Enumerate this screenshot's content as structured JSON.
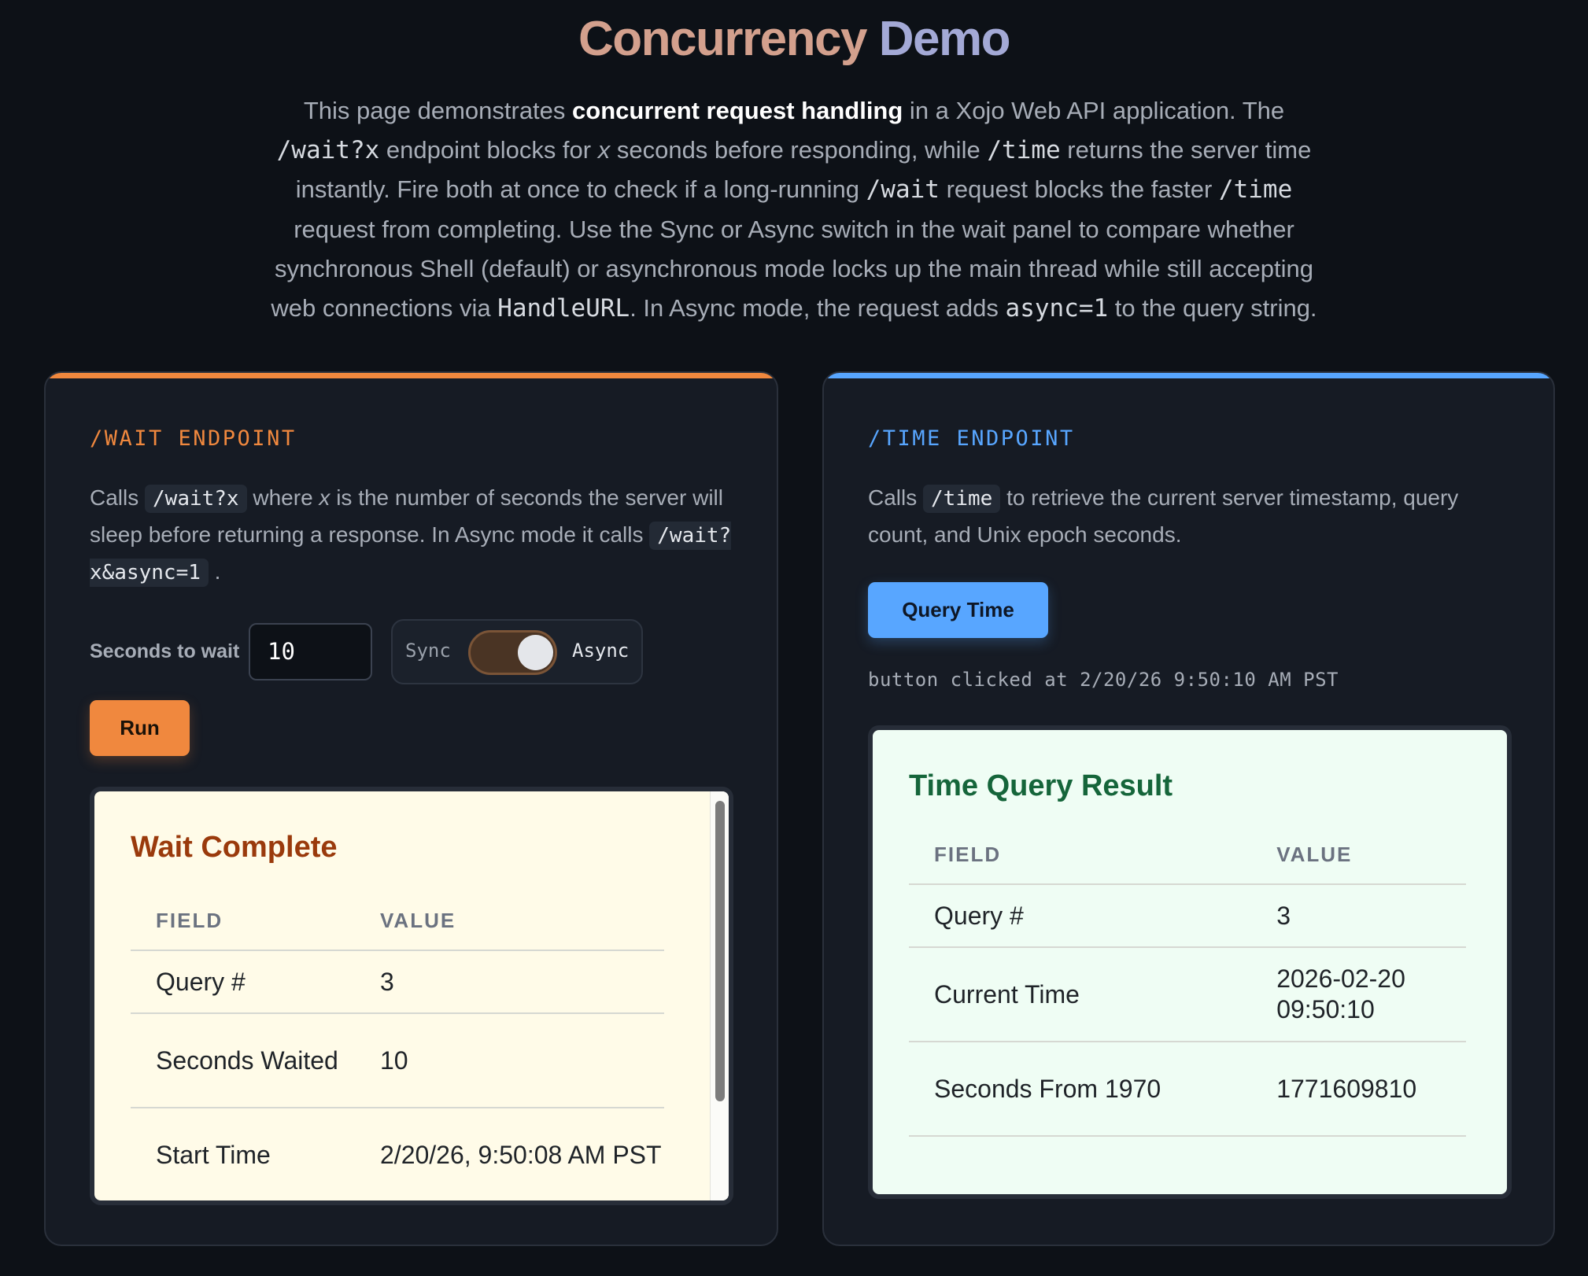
{
  "header": {
    "title_part1": "Concurrency",
    "title_part2": "Demo",
    "intro": {
      "s1": "This page demonstrates ",
      "s1_bold": "concurrent request handling",
      "s2": " in a Xojo Web API application. The ",
      "code_wait_x": "/wait?x",
      "s3": " endpoint blocks for ",
      "x_italic": "x",
      "s4": " seconds before responding, while ",
      "code_time": "/time",
      "s5": " returns the server time instantly. Fire both at once to check if a long-running ",
      "code_wait": "/wait",
      "s6": " request blocks the faster ",
      "code_time2": "/time",
      "s7": " request from completing. Use the Sync or Async switch in the wait panel to compare whether synchronous Shell (default) or asynchronous mode locks up the main thread while still accepting web connections via ",
      "code_handleurl": "HandleURL",
      "s8": ". In Async mode, the request adds ",
      "code_async": "async=1",
      "s9": " to the query string."
    }
  },
  "wait_panel": {
    "eyebrow": "/WAIT ENDPOINT",
    "desc": {
      "p1": "Calls ",
      "chip1": "/wait?x",
      "p2": " where ",
      "x_italic": "x",
      "p3": " is the number of seconds the server will sleep before returning a response. In Async mode it calls ",
      "chip2": "/wait?x&async=1",
      "p4": " ."
    },
    "seconds_label": "Seconds to wait",
    "seconds_value": "10",
    "toggle": {
      "left_label": "Sync",
      "right_label": "Async",
      "state": "async"
    },
    "run_label": "Run",
    "result": {
      "title": "Wait Complete",
      "col_field": "FIELD",
      "col_value": "VALUE",
      "rows": [
        {
          "field": "Query #",
          "value": "3"
        },
        {
          "field": "Seconds Waited",
          "value": "10"
        },
        {
          "field": "Start Time",
          "value": "2/20/26, 9:50:08 AM PST"
        }
      ]
    }
  },
  "time_panel": {
    "eyebrow": "/TIME ENDPOINT",
    "desc": {
      "p1": "Calls ",
      "chip1": "/time",
      "p2": " to retrieve the current server timestamp, query count, and Unix epoch seconds."
    },
    "query_label": "Query Time",
    "clicked_text": "button clicked at 2/20/26 9:50:10 AM PST",
    "result": {
      "title": "Time Query Result",
      "col_field": "FIELD",
      "col_value": "VALUE",
      "rows": [
        {
          "field": "Query #",
          "value": "3"
        },
        {
          "field": "Current Time",
          "value": "2026-02-20 09:50:10"
        },
        {
          "field": "Seconds From 1970",
          "value": "1771609810"
        }
      ]
    }
  },
  "colors": {
    "background": "#0d1117",
    "wait_accent": "#f0883e",
    "time_accent": "#58a6ff",
    "wait_result_bg": "#fffbe8",
    "time_result_bg": "#effdf4"
  }
}
